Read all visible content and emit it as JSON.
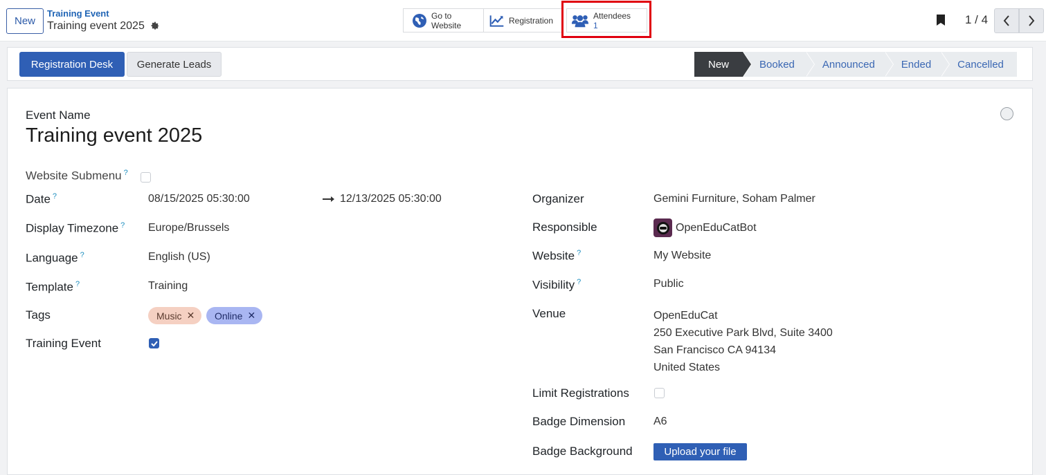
{
  "topbar": {
    "new_label": "New",
    "breadcrumb_parent": "Training Event",
    "breadcrumb_current": "Training event 2025",
    "smart_buttons": {
      "website_line1": "Go to",
      "website_line2": "Website",
      "registration": "Registration",
      "attendees_label": "Attendees",
      "attendees_count": "1"
    },
    "pager": "1 / 4"
  },
  "statusbar": {
    "primary_button": "Registration Desk",
    "secondary_button": "Generate Leads",
    "stages": [
      "New",
      "Booked",
      "Announced",
      "Ended",
      "Cancelled"
    ],
    "active_stage": "New"
  },
  "form": {
    "event_name_label": "Event Name",
    "event_name": "Training event 2025",
    "website_submenu_label": "Website Submenu",
    "date_label": "Date",
    "date_start": "08/15/2025 05:30:00",
    "date_end": "12/13/2025 05:30:00",
    "timezone_label": "Display Timezone",
    "timezone": "Europe/Brussels",
    "language_label": "Language",
    "language": "English (US)",
    "template_label": "Template",
    "template": "Training",
    "tags_label": "Tags",
    "tags": [
      {
        "name": "Music",
        "color": "#f5d0c2"
      },
      {
        "name": "Online",
        "color": "#a9b6f2"
      }
    ],
    "training_event_label": "Training Event",
    "training_event": true,
    "organizer_label": "Organizer",
    "organizer": "Gemini Furniture, Soham Palmer",
    "responsible_label": "Responsible",
    "responsible": "OpenEduCatBot",
    "website_label": "Website",
    "website": "My Website",
    "visibility_label": "Visibility",
    "visibility": "Public",
    "venue_label": "Venue",
    "venue_lines": [
      "OpenEduCat",
      "250 Executive Park Blvd, Suite 3400",
      "San Francisco CA 94134",
      "United States"
    ],
    "limit_label": "Limit Registrations",
    "badge_dim_label": "Badge Dimension",
    "badge_dim": "A6",
    "badge_bg_label": "Badge Background",
    "upload_label": "Upload your file"
  },
  "colors": {
    "primary": "#2f5fb5",
    "highlight": "#e0000f",
    "active_stage": "#3a3d41"
  }
}
